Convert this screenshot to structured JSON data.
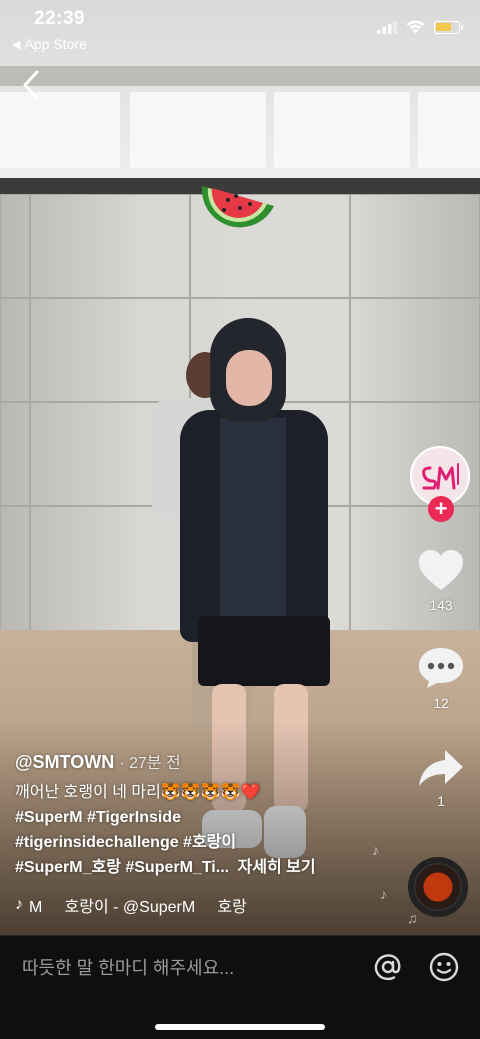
{
  "status_bar": {
    "time": "22:39",
    "back_app_label": "App Store",
    "battery_level": 0.7
  },
  "video": {
    "sticker_icon": "watermelon-icon"
  },
  "actions": {
    "avatar_label": "SM",
    "follow_icon": "plus-icon",
    "like_count": "143",
    "comment_count": "12",
    "share_count": "1"
  },
  "caption": {
    "author": "@SMTOWN",
    "age": "· 27분 전",
    "line1": "깨어난 호랭이 네 마리🐯🐯🐯🐯❤️",
    "line2": "#SuperM #TigerInside",
    "line3": "#tigerinsidechallenge #호랑이",
    "line4": "#SuperM_호랑 #SuperM_Ti...",
    "see_more": "자세히 보기"
  },
  "music": {
    "text": "M     호랑이 - @SuperM     호랑"
  },
  "comment_bar": {
    "placeholder": "따듯한 말 한마디 해주세요..."
  }
}
